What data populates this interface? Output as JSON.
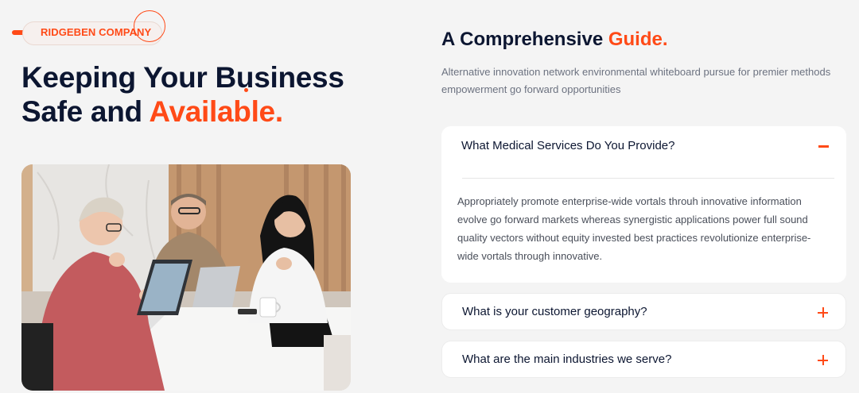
{
  "badge": {
    "label": "RIDGEBEN COMPANY"
  },
  "hero": {
    "title_line1": "Keeping Your Business",
    "title_line2_plain": "Safe and ",
    "title_line2_accent": "Available."
  },
  "guide": {
    "title_plain": "A Comprehensive ",
    "title_accent": "Guide.",
    "description": "Alternative innovation network environmental whiteboard pursue for premier methods empowerment go forward opportunities"
  },
  "faq": [
    {
      "question": "What Medical Services Do You Provide?",
      "answer": "Appropriately promote enterprise-wide vortals throuh innovative information evolve go forward markets whereas synergistic applications power full sound quality vectors without equity invested best practices revolutionize enterprise-wide vortals through innovative.",
      "expanded": true
    },
    {
      "question": "What is your customer geography?",
      "expanded": false
    },
    {
      "question": "What are the main industries we serve?",
      "expanded": false
    }
  ],
  "colors": {
    "accent": "#ff4a17",
    "heading": "#0c1631",
    "body_text": "#6c7280",
    "background": "#f4f4f4"
  },
  "icons": {
    "collapse": "minus-icon",
    "expand": "plus-icon"
  }
}
